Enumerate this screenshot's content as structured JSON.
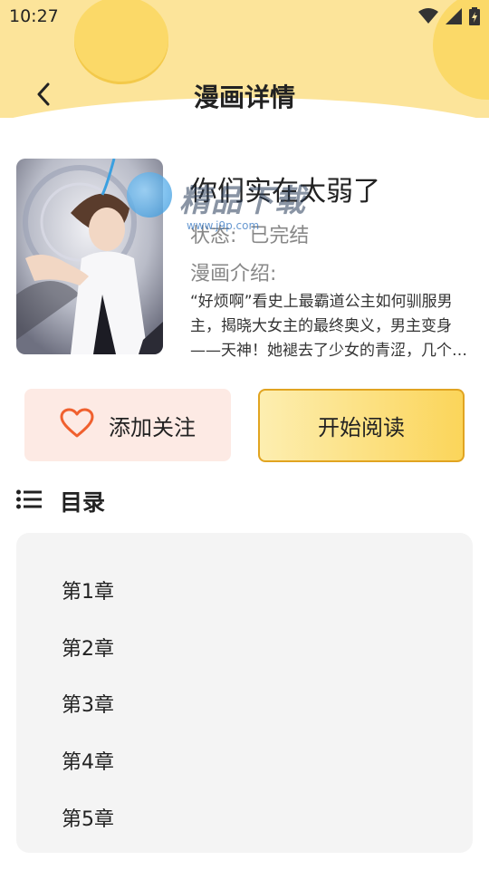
{
  "status_bar": {
    "time": "10:27"
  },
  "header": {
    "title": "漫画详情"
  },
  "book": {
    "title": "你们实在太弱了",
    "status_label": "状态:",
    "status_value": "已完结",
    "intro_label": "漫画介绍:",
    "intro": "“好烦啊”看史上最霸道公主如何驯服男主，揭晓大女主的最终奥义，男主变身——天神！她褪去了少女的青涩，几个…"
  },
  "watermark": {
    "text": "精品下载",
    "url": "www.j9p.com"
  },
  "actions": {
    "follow_label": "添加关注",
    "read_label": "开始阅读"
  },
  "toc": {
    "title": "目录",
    "chapters": [
      "第1章",
      "第2章",
      "第3章",
      "第4章",
      "第5章"
    ]
  },
  "colors": {
    "header_bg": "#fce49a",
    "accent_yellow": "#fbd55a",
    "follow_bg": "#fdeae4",
    "heart": "#f0602e"
  }
}
